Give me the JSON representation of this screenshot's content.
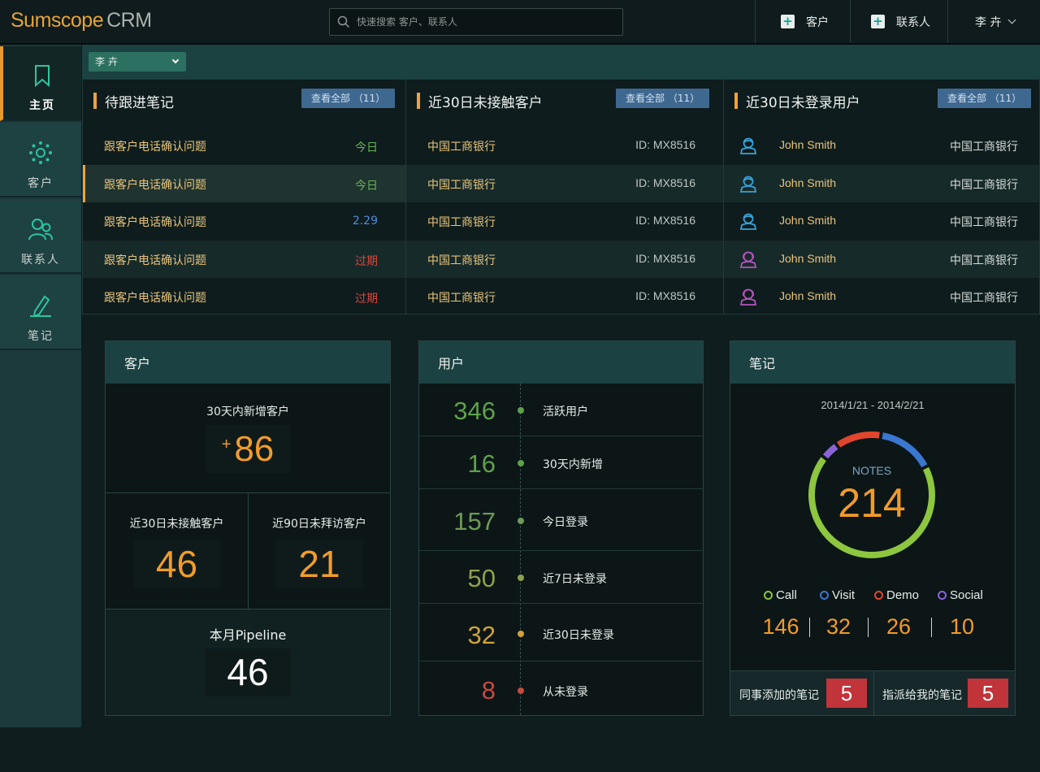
{
  "app": {
    "brand": "Sumscope",
    "product": "CRM"
  },
  "search": {
    "placeholder": "快速搜索 客户、联系人"
  },
  "header": {
    "add_customer": "客户",
    "add_contact": "联系人",
    "user_name": "李 卉"
  },
  "sidebar": {
    "items": [
      {
        "label": "主页",
        "icon": "bookmark-icon"
      },
      {
        "label": "客户",
        "icon": "sun-circle-icon"
      },
      {
        "label": "联系人",
        "icon": "contacts-icon"
      },
      {
        "label": "笔记",
        "icon": "pen-icon"
      }
    ]
  },
  "filter": {
    "user": "李 卉"
  },
  "panels": {
    "notes": {
      "title": "待跟进笔记",
      "view_all": "查看全部 （11）",
      "rows": [
        {
          "text": "跟客户电话确认问题",
          "status": "今日",
          "color": "#67b35a"
        },
        {
          "text": "跟客户电话确认问题",
          "status": "今日",
          "color": "#67b35a"
        },
        {
          "text": "跟客户电话确认问题",
          "status": "2.29",
          "color": "#4f8edc"
        },
        {
          "text": "跟客户电话确认问题",
          "status": "过期",
          "color": "#d9453d"
        },
        {
          "text": "跟客户电话确认问题",
          "status": "过期",
          "color": "#d9453d"
        }
      ]
    },
    "untouched": {
      "title": "近30日未接触客户",
      "view_all": "查看全部 （11）",
      "rows": [
        {
          "name": "中国工商银行",
          "id": "ID: MX8516"
        },
        {
          "name": "中国工商银行",
          "id": "ID: MX8516"
        },
        {
          "name": "中国工商银行",
          "id": "ID: MX8516"
        },
        {
          "name": "中国工商银行",
          "id": "ID: MX8516"
        },
        {
          "name": "中国工商银行",
          "id": "ID: MX8516"
        }
      ]
    },
    "not_logged": {
      "title": "近30日未登录用户",
      "view_all": "查看全部 （11）",
      "rows": [
        {
          "name": "John Smith",
          "company": "中国工商银行",
          "icon_color": "#3aa2d8"
        },
        {
          "name": "John Smith",
          "company": "中国工商银行",
          "icon_color": "#3aa2d8"
        },
        {
          "name": "John Smith",
          "company": "中国工商银行",
          "icon_color": "#3aa2d8"
        },
        {
          "name": "John Smith",
          "company": "中国工商银行",
          "icon_color": "#b255b8"
        },
        {
          "name": "John Smith",
          "company": "中国工商银行",
          "icon_color": "#b255b8"
        }
      ]
    }
  },
  "customers_card": {
    "title": "客户",
    "new_label": "30天内新增客户",
    "new_prefix": "+",
    "new_value": "86",
    "untouched_label": "近30日未接触客户",
    "untouched_value": "46",
    "unvisited_label": "近90日未拜访客户",
    "unvisited_value": "21",
    "pipeline_label": "本月Pipeline",
    "pipeline_value": "46"
  },
  "users_card": {
    "title": "用户",
    "rows": [
      {
        "value": "346",
        "label": "活跃用户",
        "color": "#5fa04b"
      },
      {
        "value": "16",
        "label": "30天内新增",
        "color": "#5fa04b"
      },
      {
        "value": "157",
        "label": "今日登录",
        "color": "#6d9a56"
      },
      {
        "value": "50",
        "label": "近7日未登录",
        "color": "#8fa04a"
      },
      {
        "value": "32",
        "label": "近30日未登录",
        "color": "#d0a23a"
      },
      {
        "value": "8",
        "label": "从未登录",
        "color": "#c64a40"
      }
    ]
  },
  "notes_card": {
    "title": "笔记",
    "date_range": "2014/1/21 - 2014/2/21",
    "donut_label": "NOTES",
    "total": "214",
    "legend": [
      {
        "label": "Call",
        "value": "146",
        "color": "#8dc63f"
      },
      {
        "label": "Visit",
        "value": "32",
        "color": "#3a77d0"
      },
      {
        "label": "Demo",
        "value": "26",
        "color": "#e2452e"
      },
      {
        "label": "Social",
        "value": "10",
        "color": "#8b63d6"
      }
    ],
    "colleague_label": "同事添加的笔记",
    "colleague_value": "5",
    "assigned_label": "指派给我的笔记",
    "assigned_value": "5"
  }
}
